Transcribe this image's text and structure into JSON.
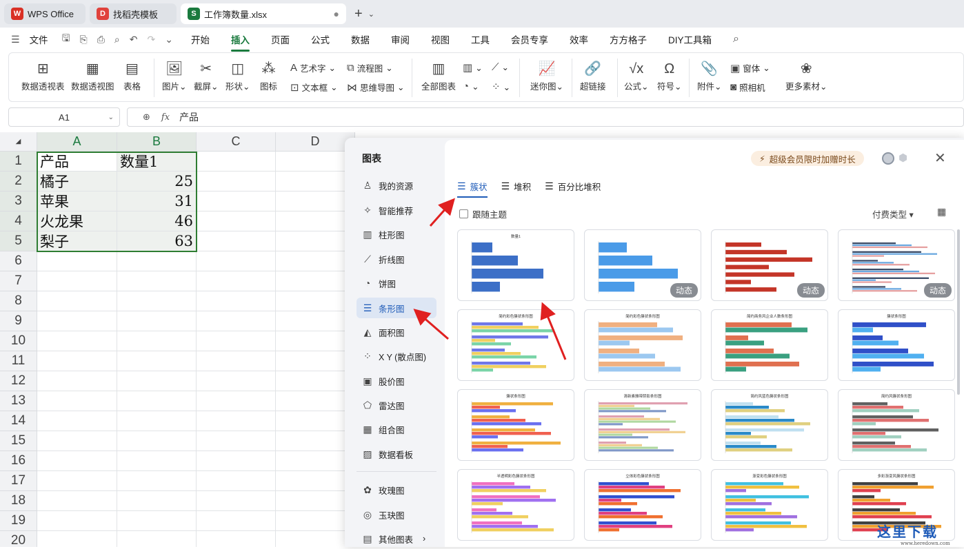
{
  "tabs": [
    {
      "label": "WPS Office",
      "icon": "wps-logo-icon",
      "color": "#d93025"
    },
    {
      "label": "找稻壳模板",
      "icon": "docer-logo-icon",
      "color": "#e0423c"
    },
    {
      "label": "工作簿数量.xlsx",
      "icon": "sheet-file-icon",
      "color": "#1a7a3e"
    }
  ],
  "menu": {
    "file": "文件",
    "items": [
      "开始",
      "插入",
      "页面",
      "公式",
      "数据",
      "审阅",
      "视图",
      "工具",
      "会员专享",
      "效率",
      "方方格子",
      "DIY工具箱"
    ],
    "active": "插入"
  },
  "ribbon": {
    "pivot_table": "数据透视表",
    "pivot_chart": "数据透视图",
    "table": "表格",
    "picture": "图片",
    "screenshot": "截屏",
    "shape": "形状",
    "icon": "图标",
    "wordart": "艺术字",
    "textbox": "文本框",
    "flowchart": "流程图",
    "mindmap": "思维导图",
    "all_charts": "全部图表",
    "sparkline": "迷你图",
    "hyperlink": "超链接",
    "formula": "公式",
    "symbol": "符号",
    "attachment": "附件",
    "form": "窗体",
    "camera": "照相机",
    "more": "更多素材"
  },
  "formula_bar": {
    "cell_ref": "A1",
    "fx": "fx",
    "value": "产品"
  },
  "sheet": {
    "columns": [
      "A",
      "B",
      "C",
      "D"
    ],
    "rows": [
      "1",
      "2",
      "3",
      "4",
      "5",
      "6",
      "7",
      "8",
      "9",
      "10",
      "11",
      "12",
      "13",
      "14",
      "15",
      "16",
      "17",
      "18",
      "19",
      "20"
    ],
    "data": [
      [
        "产品",
        "数量1"
      ],
      [
        "橘子",
        "25"
      ],
      [
        "苹果",
        "31"
      ],
      [
        "火龙果",
        "46"
      ],
      [
        "梨子",
        "63"
      ]
    ]
  },
  "dialog": {
    "title": "图表",
    "categories": [
      {
        "label": "我的资源",
        "icon": "user-icon"
      },
      {
        "label": "智能推荐",
        "icon": "smart-icon"
      },
      {
        "label": "柱形图",
        "icon": "column-chart-icon"
      },
      {
        "label": "折线图",
        "icon": "line-chart-icon"
      },
      {
        "label": "饼图",
        "icon": "pie-chart-icon"
      },
      {
        "label": "条形图",
        "icon": "bar-chart-icon"
      },
      {
        "label": "面积图",
        "icon": "area-chart-icon"
      },
      {
        "label": "X Y (散点图)",
        "icon": "scatter-chart-icon"
      },
      {
        "label": "股价图",
        "icon": "stock-chart-icon"
      },
      {
        "label": "雷达图",
        "icon": "radar-chart-icon"
      },
      {
        "label": "组合图",
        "icon": "combo-chart-icon"
      },
      {
        "label": "数据看板",
        "icon": "dashboard-icon"
      },
      {
        "label": "玫瑰图",
        "icon": "rose-chart-icon"
      },
      {
        "label": "玉玦图",
        "icon": "ring-chart-icon"
      },
      {
        "label": "其他图表",
        "icon": "other-chart-icon"
      }
    ],
    "active_category": "条形图",
    "promo": "超级会员限时加赠时长",
    "subtabs": [
      "簇状",
      "堆积",
      "百分比堆积"
    ],
    "follow_theme": "跟随主题",
    "pay_type": "付费类型",
    "dynamic_badge": "动态",
    "thumb_titles": [
      "数量1",
      "",
      "",
      "",
      "简约彩色簇状条形图",
      "简约彩色簇状条形图",
      "简约商务风企业人数条形图",
      "簇状条形图",
      "簇状条形图",
      "清新素雅带阴影条形图",
      "简约风蓝色簇状条形图",
      "简约风簇状条形图",
      "半透明彩色簇状条形图",
      "立体彩色簇状条形图",
      "渐变彩色簇状条形图",
      "多彩渐变风簇状条形图"
    ]
  },
  "colors": {
    "accent_green": "#1a7a3e",
    "accent_blue": "#1e5bb8",
    "arrow_red": "#e02020"
  },
  "watermark": {
    "main": "这里下载",
    "sub": "www.heredown.com"
  }
}
